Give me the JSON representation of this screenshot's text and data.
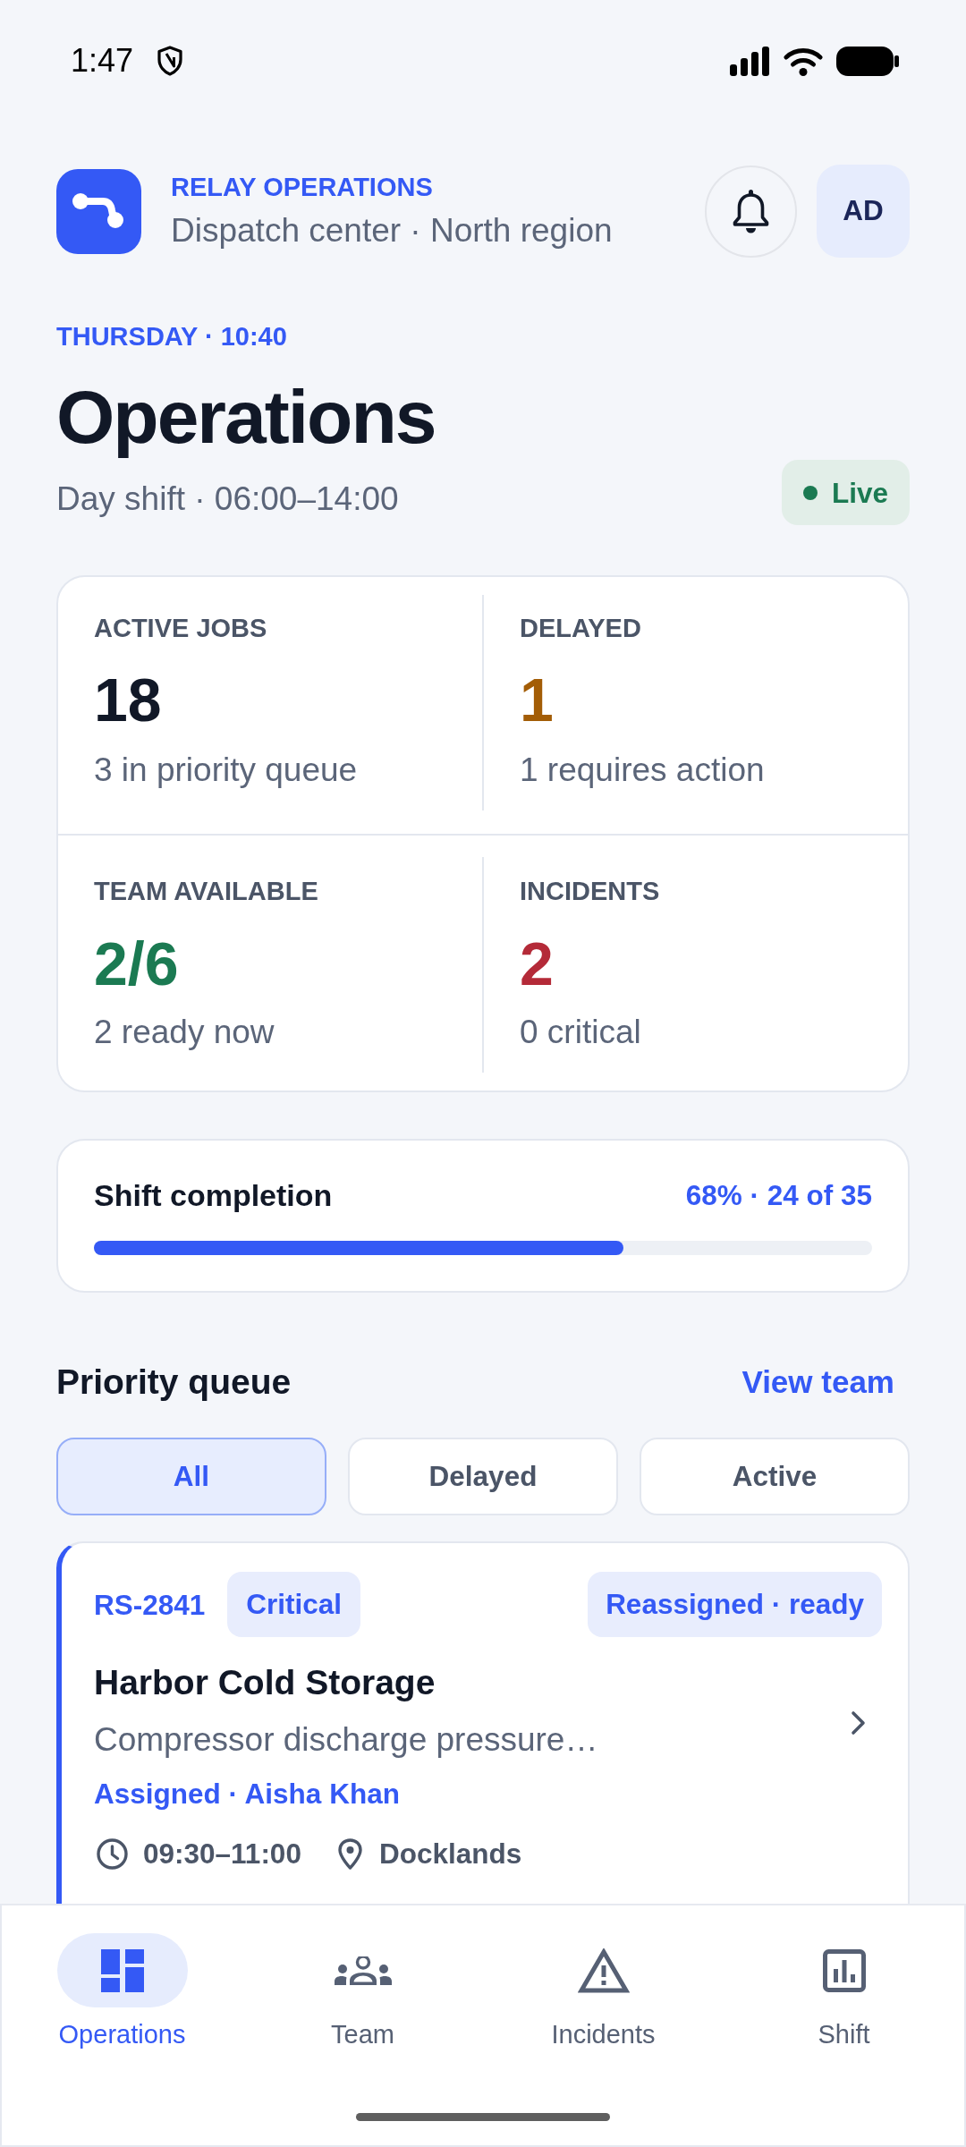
{
  "status_bar": {
    "time": "1:47"
  },
  "header": {
    "brand": "RELAY OPERATIONS",
    "subtitle": "Dispatch center · North region",
    "avatar": "AD"
  },
  "page": {
    "eyebrow": "THURSDAY · 10:40",
    "title": "Operations",
    "shift": "Day shift · 06:00–14:00",
    "status": "Live"
  },
  "stats": [
    {
      "label": "ACTIVE JOBS",
      "value": "18",
      "note": "3 in priority queue",
      "color": "#111827"
    },
    {
      "label": "DELAYED",
      "value": "1",
      "note": "1 requires action",
      "color": "#a35d06"
    },
    {
      "label": "TEAM AVAILABLE",
      "value": "2/6",
      "note": "2 ready now",
      "color": "#1b7a52"
    },
    {
      "label": "INCIDENTS",
      "value": "2",
      "note": "0 critical",
      "color": "#b42a38"
    }
  ],
  "progress": {
    "label": "Shift completion",
    "reading": "68% · 24 of 35",
    "level": 0.68
  },
  "queue": {
    "title": "Priority queue",
    "link": "View team",
    "filters": [
      {
        "label": "All",
        "selected": true
      },
      {
        "label": "Delayed",
        "selected": false
      },
      {
        "label": "Active",
        "selected": false
      }
    ],
    "jobs": [
      {
        "id": "RS-2841",
        "priority": "Critical",
        "status": "Reassigned · ready",
        "title": "Harbor Cold Storage",
        "description": "Compressor discharge pressure…",
        "assignee": "Assigned · Aisha Khan",
        "time": "09:30–11:00",
        "location": "Docklands"
      }
    ]
  },
  "nav": [
    {
      "label": "Operations",
      "selected": true
    },
    {
      "label": "Team",
      "selected": false
    },
    {
      "label": "Incidents",
      "selected": false
    },
    {
      "label": "Shift",
      "selected": false
    }
  ]
}
